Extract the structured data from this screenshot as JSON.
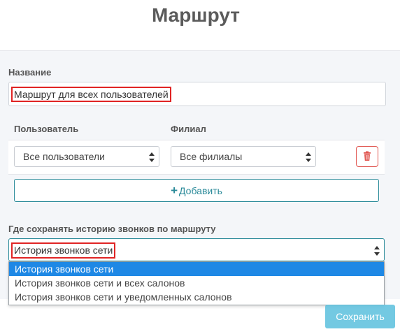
{
  "page": {
    "title": "Маршрут"
  },
  "form": {
    "name_label": "Название",
    "name_value": "Маршрут для всех пользователей",
    "user_label": "Пользователь",
    "branch_label": "Филиал",
    "user_select_value": "Все пользователи",
    "branch_select_value": "Все филиалы",
    "delete_icon": "trash-icon",
    "add_label": "Добавить",
    "history_label": "Где сохранять историю звонков по маршруту",
    "history_value": "История звонков сети",
    "history_options": [
      "История звонков сети",
      "История звонков сети и всех салонов",
      "История звонков сети и уведомленных салонов"
    ],
    "history_selected_index": 0
  },
  "footer": {
    "save_label": "Сохранить"
  },
  "colors": {
    "accent": "#2a8a99",
    "danger": "#e0554f",
    "highlight": "#e02424",
    "dropdown_selected": "#1e88e5",
    "save_button": "#5bc0de"
  }
}
